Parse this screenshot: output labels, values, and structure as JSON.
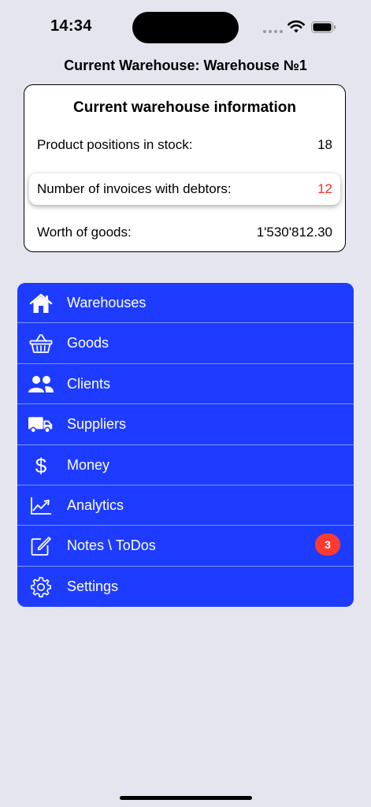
{
  "status_bar": {
    "time": "14:34"
  },
  "header": {
    "title": "Current Warehouse: Warehouse №1"
  },
  "info_card": {
    "title": "Current warehouse information",
    "rows": [
      {
        "label": "Product positions in stock:",
        "value": "18"
      },
      {
        "label": "Number of invoices with debtors:",
        "value": "12",
        "value_color": "#ff2a1f"
      },
      {
        "label": "Worth of goods:",
        "value": "1'530'812.30"
      }
    ]
  },
  "menu": {
    "accent_color": "#1e3cff",
    "items": [
      {
        "label": "Warehouses",
        "icon": "house-icon"
      },
      {
        "label": "Goods",
        "icon": "basket-icon"
      },
      {
        "label": "Clients",
        "icon": "people-icon"
      },
      {
        "label": "Suppliers",
        "icon": "truck-icon"
      },
      {
        "label": "Money",
        "icon": "dollar-icon",
        "glyph": "$"
      },
      {
        "label": "Analytics",
        "icon": "chart-icon"
      },
      {
        "label": "Notes \\ ToDos",
        "icon": "note-edit-icon",
        "badge": "3"
      },
      {
        "label": "Settings",
        "icon": "gear-icon"
      }
    ]
  }
}
